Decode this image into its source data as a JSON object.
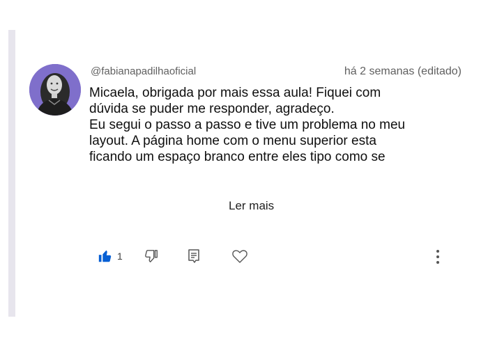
{
  "comment": {
    "author": "@fabianapadilhaoficial",
    "timestamp": "há 2 semanas (editado)",
    "body_lines": [
      "Micaela, obrigada por mais essa aula! Fiquei com",
      "dúvida se puder me responder, agradeço.",
      "Eu segui o passo a passo e tive um problema no meu",
      "layout. A página home com o menu superior esta",
      "ficando um espaço branco entre eles tipo como se"
    ],
    "read_more_label": "Ler mais"
  },
  "actions": {
    "like_count": "1",
    "like_icon": "thumb-up-icon",
    "dislike_icon": "thumb-down-icon",
    "reply_icon": "reply-comment-icon",
    "heart_icon": "heart-icon",
    "more_icon": "more-vert-icon"
  },
  "colors": {
    "accent": "#065fd4",
    "meta_text": "#606060",
    "left_rule": "#e7e5ed",
    "avatar_bg": "#7f6fcb"
  }
}
